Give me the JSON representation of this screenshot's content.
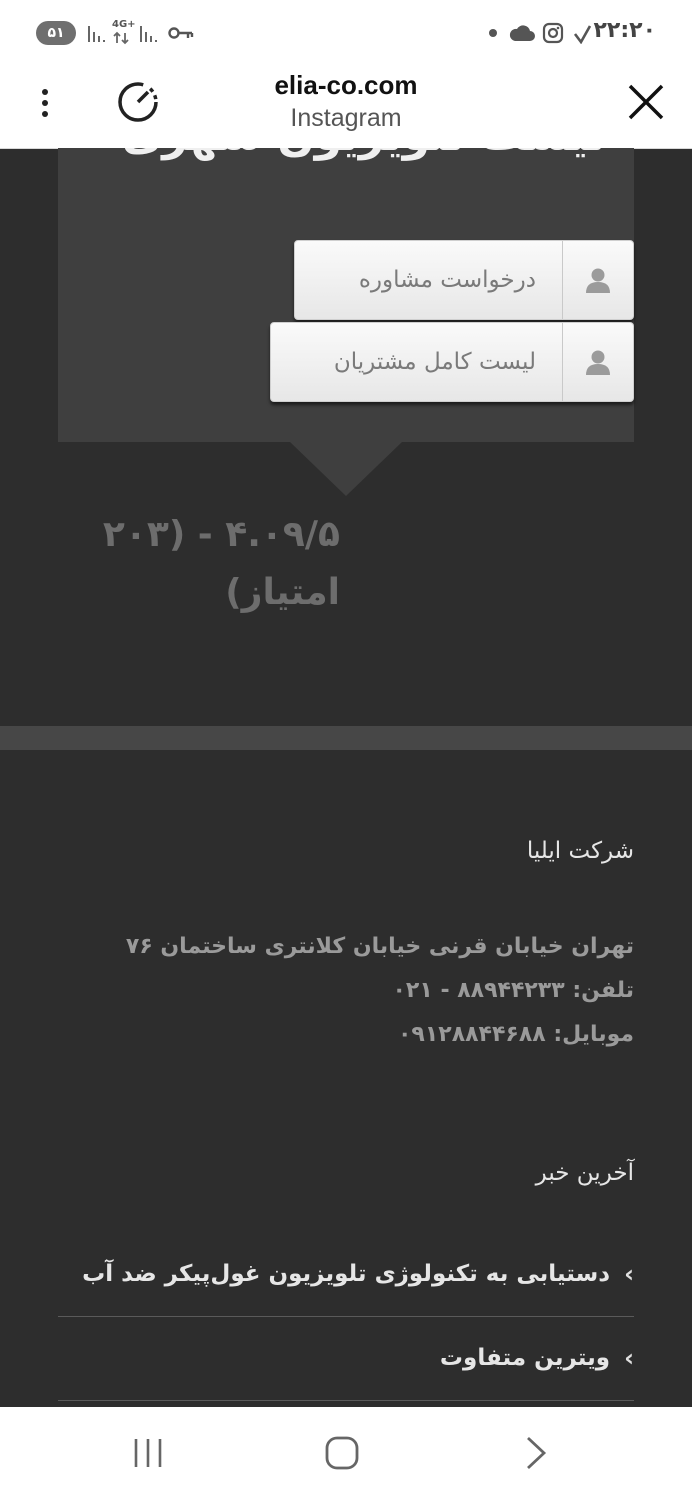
{
  "status_bar": {
    "battery": "۵۱",
    "network": "4G+",
    "time": "۲۲:۲۰"
  },
  "browser": {
    "url": "elia-co.com",
    "subtitle": "Instagram"
  },
  "panel": {
    "title_partial": "لیست تلویزیون شهری",
    "buttons": [
      {
        "label": "درخواست مشاوره",
        "icon": "user-icon"
      },
      {
        "label": "لیست کامل مشتریان",
        "icon": "user-icon"
      }
    ]
  },
  "rating": {
    "line1": "۴.۰۹/۵ - (۲۰۳",
    "line2": "امتیاز)"
  },
  "footer": {
    "company_heading": "شرکت ایلیا",
    "address": "تهران خیابان قرنی خیابان کلانتری ساختمان ۷۶",
    "phone": "تلفن: ۸۸۹۴۴۲۳۳ - ۰۲۱",
    "mobile": "موبایل: ۰۹۱۲۸۸۴۴۶۸۸",
    "news_heading": "آخرین خبر",
    "news_items": [
      "دستیابی به تکنولوژی تلویزیون غول‌پیکر ضد آب",
      "ویترین متفاوت"
    ]
  },
  "colors": {
    "page_bg": "#2d2d2d",
    "panel_bg": "#3f3f3f",
    "button_bg": "#f2f2f2",
    "muted_text": "#9a9a9a"
  }
}
